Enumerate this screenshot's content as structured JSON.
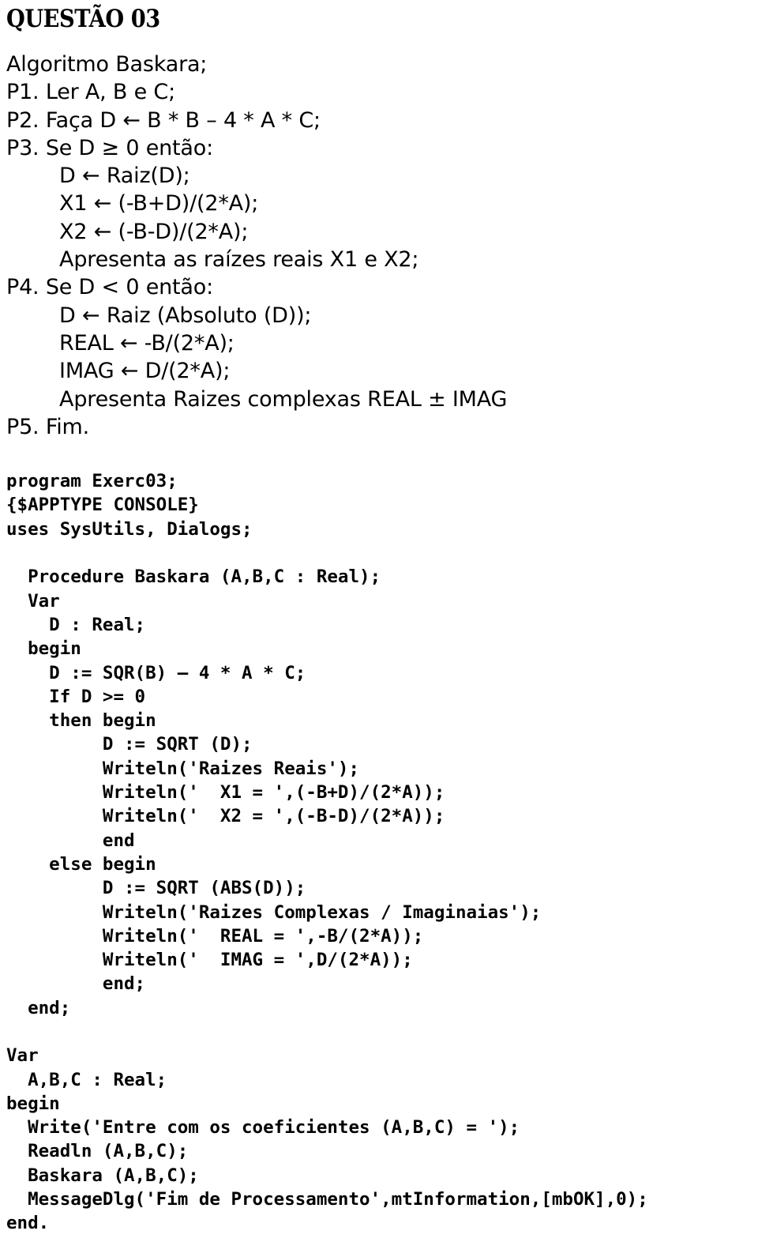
{
  "document": {
    "title": "QUESTÃO 03"
  },
  "algorithm": {
    "lines": [
      "Algoritmo Baskara;",
      "P1. Ler A, B e C;",
      "P2. Faça D ← B * B – 4 * A * C;",
      "P3. Se D ≥ 0 então:",
      "        D ← Raiz(D);",
      "        X1 ← (-B+D)/(2*A);",
      "        X2 ← (-B-D)/(2*A);",
      "        Apresenta as raízes reais X1 e X2;",
      "P4. Se D < 0 então:",
      "        D ← Raiz (Absoluto (D));",
      "        REAL ← -B/(2*A);",
      "        IMAG ← D/(2*A);",
      "        Apresenta Raizes complexas REAL ± IMAG",
      "P5. Fim."
    ]
  },
  "code": {
    "language": "pascal",
    "lines": [
      "program Exerc03;",
      "{$APPTYPE CONSOLE}",
      "uses SysUtils, Dialogs;",
      "",
      "  Procedure Baskara (A,B,C : Real);",
      "  Var",
      "    D : Real;",
      "  begin",
      "    D := SQR(B) – 4 * A * C;",
      "    If D >= 0",
      "    then begin",
      "         D := SQRT (D);",
      "         Writeln('Raizes Reais');",
      "         Writeln('  X1 = ',(-B+D)/(2*A));",
      "         Writeln('  X2 = ',(-B-D)/(2*A));",
      "         end",
      "    else begin",
      "         D := SQRT (ABS(D));",
      "         Writeln('Raizes Complexas / Imaginaias');",
      "         Writeln('  REAL = ',-B/(2*A));",
      "         Writeln('  IMAG = ',D/(2*A));",
      "         end;",
      "  end;",
      "",
      "Var",
      "  A,B,C : Real;",
      "begin",
      "  Write('Entre com os coeficientes (A,B,C) = ');",
      "  Readln (A,B,C);",
      "  Baskara (A,B,C);",
      "  MessageDlg('Fim de Processamento',mtInformation,[mbOK],0);",
      "end."
    ]
  }
}
